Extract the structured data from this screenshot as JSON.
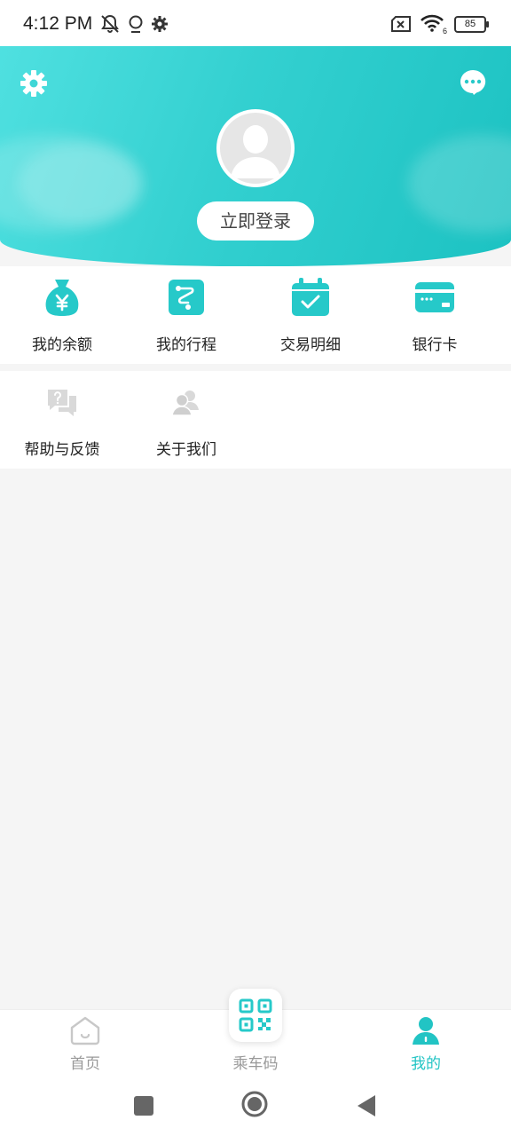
{
  "status_bar": {
    "time": "4:12 PM",
    "battery": "85",
    "wifi_badge": "6"
  },
  "header": {
    "login_label": "立即登录"
  },
  "primary_menu": [
    {
      "label": "我的余额",
      "icon": "money-bag-icon"
    },
    {
      "label": "我的行程",
      "icon": "route-icon"
    },
    {
      "label": "交易明细",
      "icon": "calendar-check-icon"
    },
    {
      "label": "银行卡",
      "icon": "bank-card-icon"
    }
  ],
  "secondary_menu": [
    {
      "label": "帮助与反馈",
      "icon": "help-feedback-icon"
    },
    {
      "label": "关于我们",
      "icon": "about-us-icon"
    }
  ],
  "bottom_nav": {
    "home": "首页",
    "code": "乘车码",
    "mine": "我的",
    "active": "mine"
  },
  "colors": {
    "accent": "#22c4c4",
    "inactive": "#999999"
  }
}
